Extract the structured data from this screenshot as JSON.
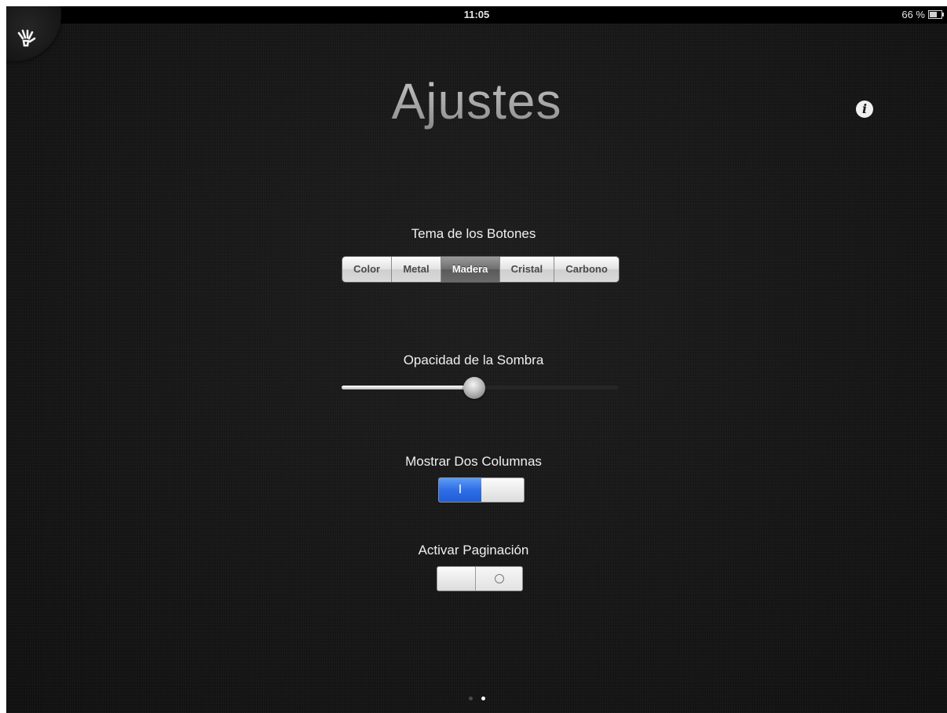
{
  "status_bar": {
    "time": "11:05",
    "battery_label": "66 %",
    "battery_level": 0.66,
    "icons": [
      "airplane-icon",
      "sync-icon",
      "battery-icon"
    ]
  },
  "header": {
    "title": "Ajustes",
    "info_icon": "i",
    "corner_icon": "hand-icon"
  },
  "button_theme": {
    "label": "Tema de los Botones",
    "options": [
      "Color",
      "Metal",
      "Madera",
      "Cristal",
      "Carbono"
    ],
    "selected_index": 2
  },
  "shadow_opacity": {
    "label": "Opacidad de la Sombra",
    "value": 0.48
  },
  "two_columns": {
    "label": "Mostrar Dos Columnas",
    "on": true,
    "on_glyph": "I"
  },
  "pagination": {
    "label": "Activar Paginación",
    "on": false,
    "off_glyph": "O"
  },
  "page_indicator": {
    "count": 2,
    "current": 2
  },
  "colors": {
    "switch_on": "#2f6ee6",
    "background": "#161616"
  }
}
